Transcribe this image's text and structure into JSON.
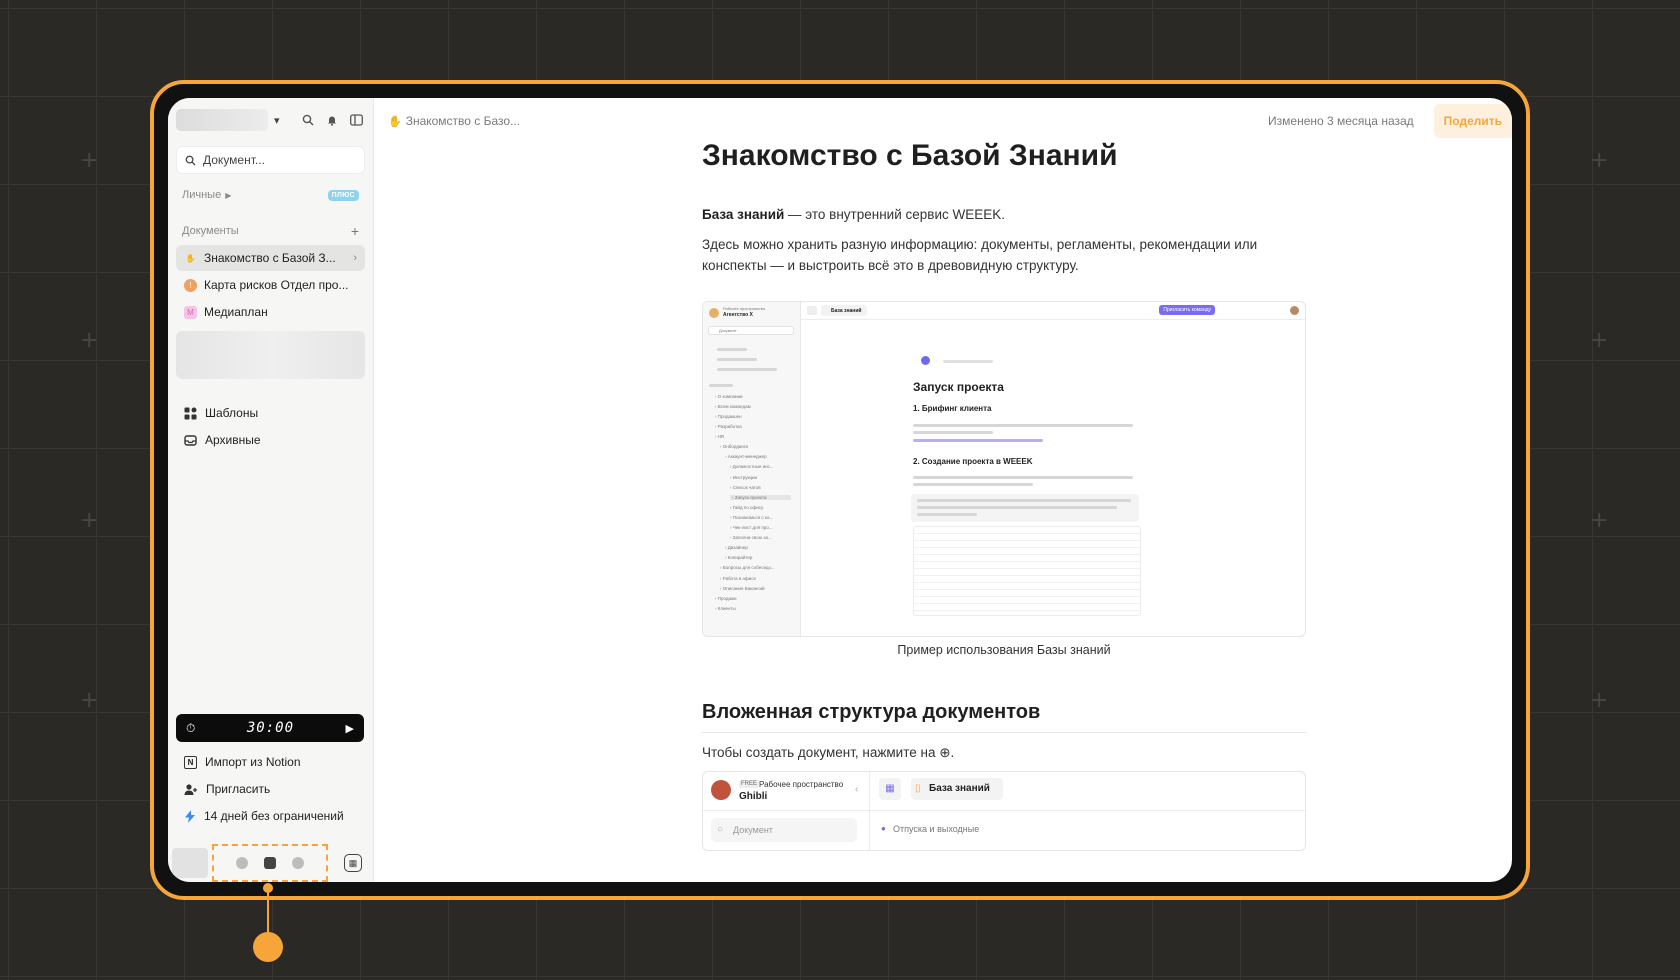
{
  "sidebar": {
    "search_placeholder": "Документ...",
    "section_personal": "Личные",
    "badge": "ПЛЮС",
    "section_docs": "Документы",
    "docs": [
      {
        "label": "Знакомство с Базой З...",
        "emoji": "✋",
        "color": "#f5c542"
      },
      {
        "label": "Карта рисков Отдел про...",
        "emoji": "!",
        "color": "#f0a060"
      },
      {
        "label": "Медиаплан",
        "emoji": "M",
        "color": "#f6c3e6"
      }
    ],
    "nav": [
      {
        "label": "Шаблоны",
        "icon": "templates-icon"
      },
      {
        "label": "Архивные",
        "icon": "archive-icon"
      }
    ],
    "timer": "30:00",
    "bottom": [
      {
        "label": "Импорт из Notion",
        "icon": "notion-icon"
      },
      {
        "label": "Пригласить",
        "icon": "invite-icon"
      },
      {
        "label": "14 дней без ограничений",
        "icon": "lightning-icon"
      }
    ]
  },
  "topbar": {
    "crumb": "Знакомство с Базо...",
    "changed": "Изменено 3 месяца назад",
    "share": "Поделить"
  },
  "doc": {
    "title": "Знакомство с Базой Знаний",
    "p1_bold": "База знаний",
    "p1_rest": " — это внутренний сервис WEEEK.",
    "p2": "Здесь можно хранить разную информацию: документы, регламенты, рекомендации или конспекты — и выстроить всё это в древовидную структуру.",
    "caption": "Пример использования Базы знаний",
    "h2": "Вложенная структура документов",
    "p3": "Чтобы создать документ, нажмите на ⊕."
  },
  "shot": {
    "workspace": "Агентство Х",
    "ws_sub": "Рабочее пространство",
    "tab": "База знаний",
    "invite": "Пригласить команду",
    "search": "Документ",
    "heading": "Запуск проекта",
    "h_1": "1. Брифинг клиента",
    "h_2": "2. Создание проекта в WEEEK",
    "tree": [
      "О компании",
      "Всем командам",
      "Продакшен",
      "Разработка",
      "HR",
      "Онбординги",
      "Аккаунт-менеджер",
      "Должностные инс...",
      "Инструкции",
      "Список чатов",
      "Запуск проекта",
      "Гайд по офису",
      "Познакомься с ко...",
      "Чек-лист для про...",
      "Заполни свою за...",
      "Дизайнер",
      "Копирайтер",
      "Вопросы для собеседо...",
      "Работа в офисе",
      "Описание Вакансий",
      "Продажи",
      "Клиенты"
    ]
  },
  "shot2": {
    "badge": "FREE",
    "ws_sub": "Рабочее пространство",
    "workspace": "Ghibli",
    "tab": "База знаний",
    "search": "Документ",
    "item": "Отпуска и выходные"
  }
}
